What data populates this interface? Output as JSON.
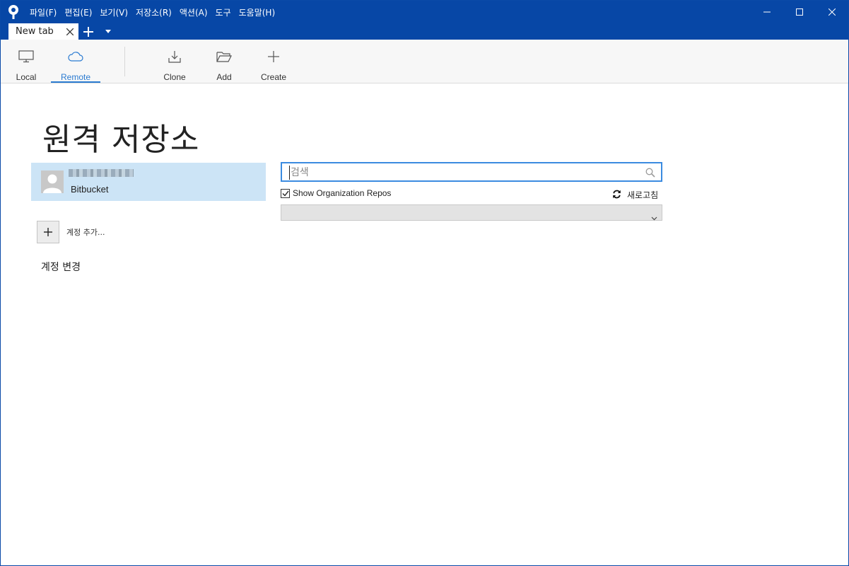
{
  "menu": {
    "items": [
      "파일(F)",
      "편집(E)",
      "보기(V)",
      "저장소(R)",
      "액션(A)",
      "도구",
      "도움말(H)"
    ]
  },
  "tabs": {
    "active_label": "New tab"
  },
  "toolbar": {
    "local_label": "Local",
    "remote_label": "Remote",
    "clone_label": "Clone",
    "add_label": "Add",
    "create_label": "Create",
    "active": "Remote"
  },
  "page": {
    "title": "원격 저장소"
  },
  "account": {
    "service": "Bitbucket"
  },
  "sidebar": {
    "add_account_label": "계정 추가...",
    "switch_account_label": "계정 변경"
  },
  "search": {
    "placeholder": "검색",
    "value": ""
  },
  "options": {
    "show_org_repos_label": "Show Organization Repos",
    "show_org_repos_checked": true,
    "refresh_label": "새로고침"
  },
  "dropdown": {
    "selected": ""
  },
  "colors": {
    "titlebar": "#0747a6",
    "accent": "#2b7bd1",
    "selected_card": "#cce4f6"
  },
  "icons": {
    "app": "sourcetree-logo-icon",
    "local": "monitor-icon",
    "remote": "cloud-icon",
    "clone": "download-icon",
    "add": "folder-icon",
    "create": "plus-icon",
    "search": "search-icon",
    "refresh": "refresh-icon"
  }
}
